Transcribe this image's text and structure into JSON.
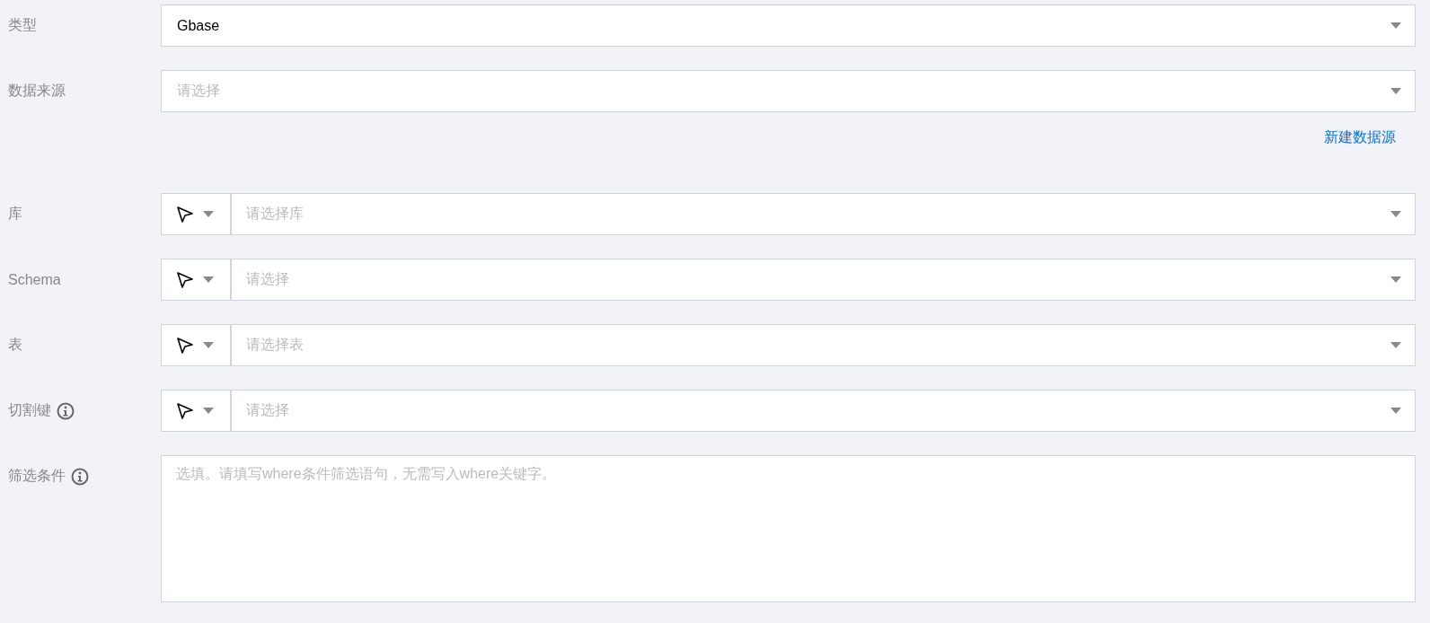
{
  "rows": [
    {
      "kind": "select",
      "label": "类型",
      "value": "Gbase"
    },
    {
      "kind": "select",
      "label": "数据来源",
      "placeholder": "请选择"
    },
    {
      "kind": "link",
      "label_link": "新建数据源"
    },
    {
      "kind": "mode-select",
      "label": "库",
      "placeholder": "请选择库"
    },
    {
      "kind": "mode-select",
      "label": "Schema",
      "placeholder": "请选择"
    },
    {
      "kind": "mode-select",
      "label": "表",
      "placeholder": "请选择表"
    },
    {
      "kind": "mode-select",
      "label": "切割键",
      "info": true,
      "placeholder": "请选择"
    },
    {
      "kind": "textarea",
      "label": "筛选条件",
      "info": true,
      "placeholder": "选填。请填写where条件筛选语句，无需写入where关键字。"
    }
  ]
}
